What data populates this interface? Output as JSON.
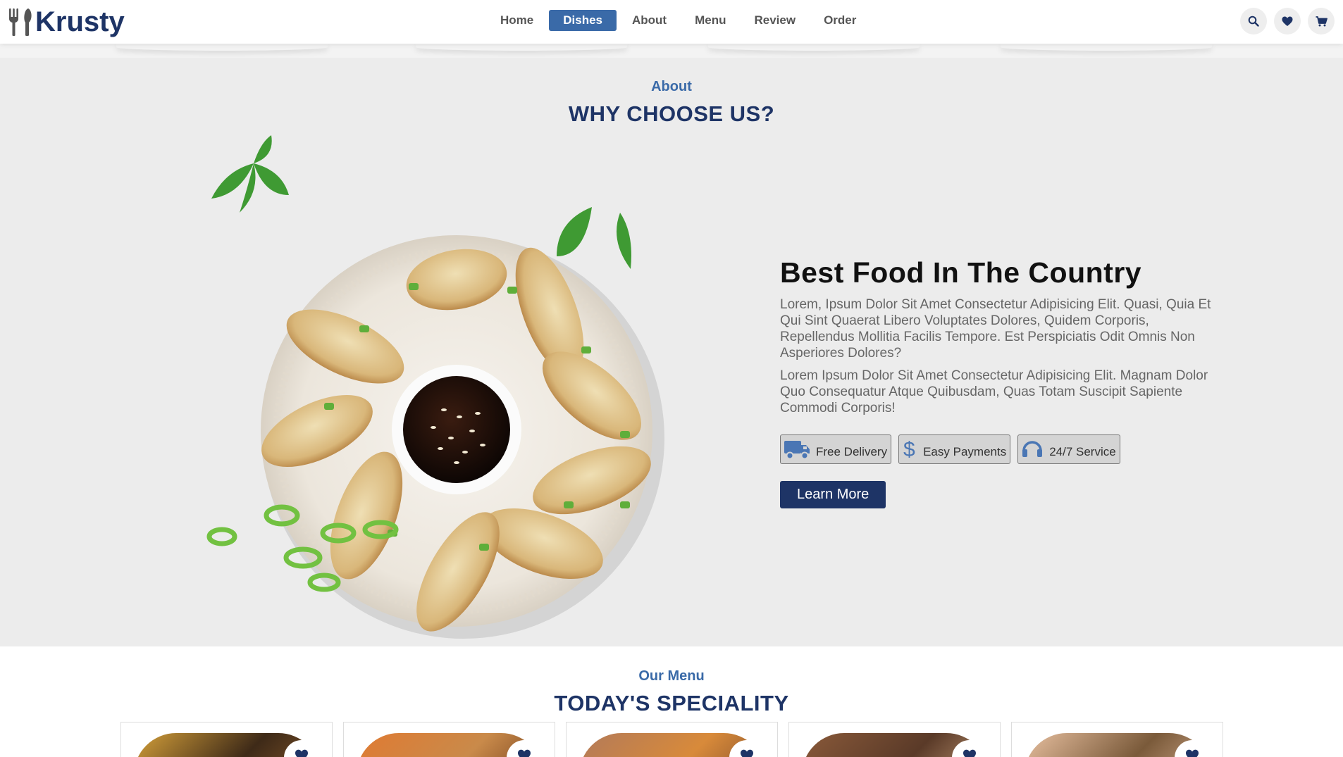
{
  "brand": {
    "name": "Krusty",
    "icon": "utensils-icon"
  },
  "nav": [
    {
      "label": "Home",
      "active": false
    },
    {
      "label": "Dishes",
      "active": true
    },
    {
      "label": "About",
      "active": false
    },
    {
      "label": "Menu",
      "active": false
    },
    {
      "label": "Review",
      "active": false
    },
    {
      "label": "Order",
      "active": false
    }
  ],
  "header_icons": [
    "search-icon",
    "heart-icon",
    "cart-icon"
  ],
  "about": {
    "sub_heading": "About",
    "heading": "WHY CHOOSE US?",
    "title": "Best Food In The Country",
    "paragraph_1": "Lorem, Ipsum Dolor Sit Amet Consectetur Adipisicing Elit. Quasi, Quia Et Qui Sint Quaerat Libero Voluptates Dolores, Quidem Corporis, Repellendus Mollitia Facilis Tempore. Est Perspiciatis Odit Omnis Non Asperiores Dolores?",
    "paragraph_2": "Lorem Ipsum Dolor Sit Amet Consectetur Adipisicing Elit. Magnam Dolor Quo Consequatur Atque Quibusdam, Quas Totam Suscipit Sapiente Commodi Corporis!",
    "features": [
      {
        "icon": "truck-icon",
        "label": "Free Delivery"
      },
      {
        "icon": "dollar-icon",
        "label": "Easy Payments"
      },
      {
        "icon": "headset-icon",
        "label": "24/7 Service"
      }
    ],
    "button_label": "Learn More"
  },
  "menu": {
    "sub_heading": "Our Menu",
    "heading": "TODAY'S SPECIALITY"
  },
  "colors": {
    "primary": "#1e3466",
    "accent": "#3a6aa8",
    "section_bg": "#ececec"
  }
}
